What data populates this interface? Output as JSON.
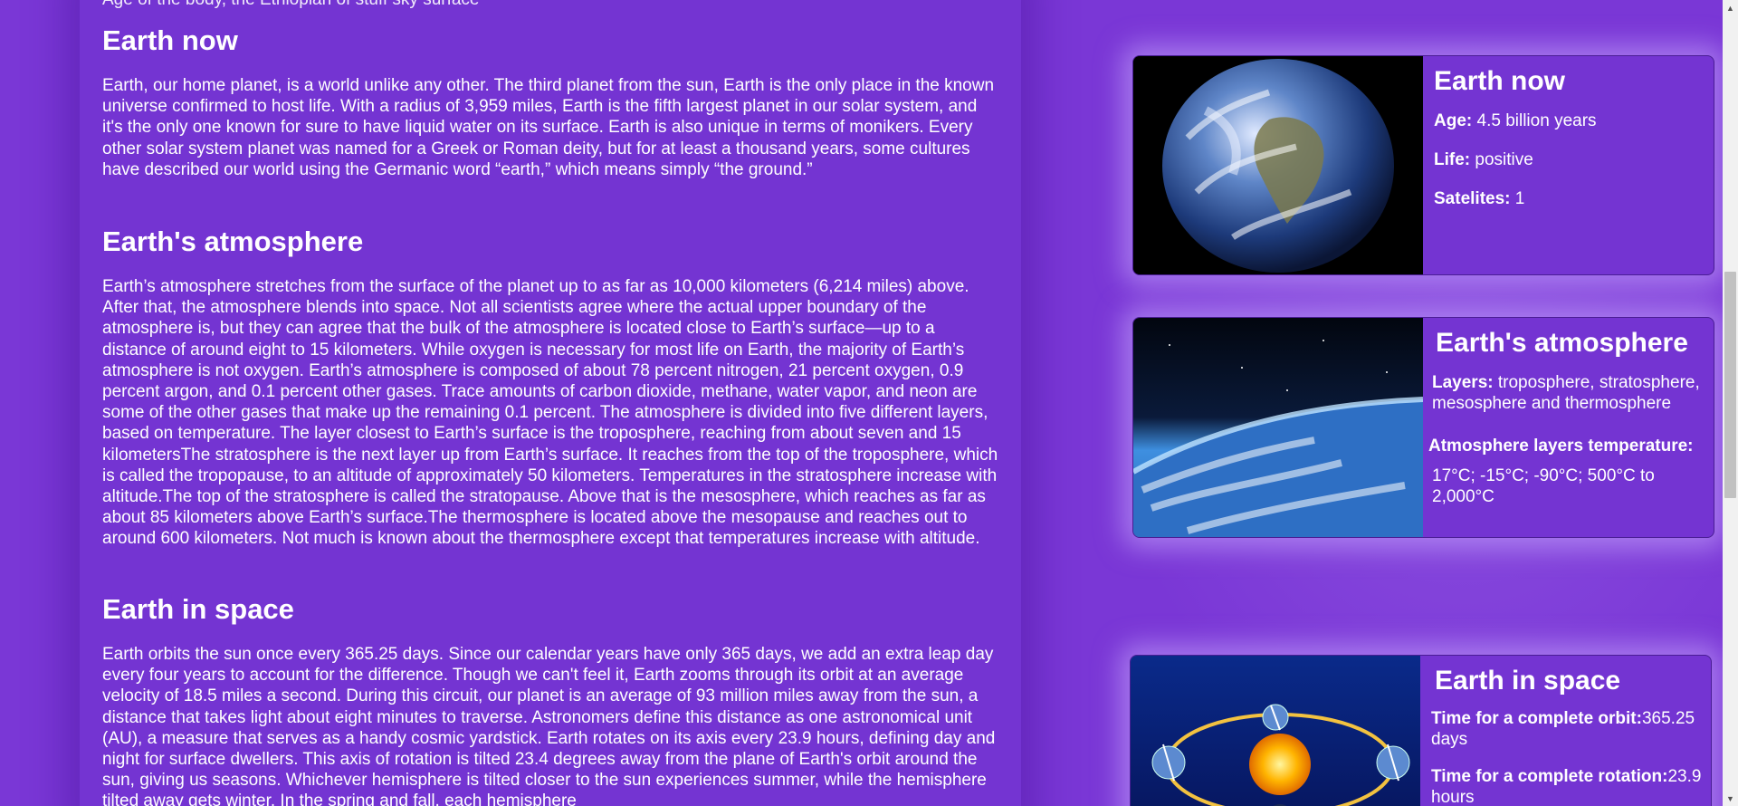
{
  "article": {
    "cut_line": "Age of the body, the Ethiopian of stuff sky surface",
    "sections": [
      {
        "heading": "Earth now",
        "body": "Earth, our home planet, is a world unlike any other. The third planet from the sun, Earth is the only place in the known universe confirmed to host life. With a radius of 3,959 miles, Earth is the fifth largest planet in our solar system, and it's the only one known for sure to have liquid water on its surface. Earth is also unique in terms of monikers. Every other solar system planet was named for a Greek or Roman deity, but for at least a thousand years, some cultures have described our world using the Germanic word “earth,” which means simply “the ground.”"
      },
      {
        "heading": "Earth's atmosphere",
        "body": "Earth’s atmosphere stretches from the surface of the planet up to as far as 10,000 kilometers (6,214 miles) above. After that, the atmosphere blends into space. Not all scientists agree where the actual upper boundary of the atmosphere is, but they can agree that the bulk of the atmosphere is located close to Earth’s surface—up to a distance of around eight to 15 kilometers. While oxygen is necessary for most life on Earth, the majority of Earth’s atmosphere is not oxygen. Earth’s atmosphere is composed of about 78 percent nitrogen, 21 percent oxygen, 0.9 percent argon, and 0.1 percent other gases. Trace amounts of carbon dioxide, methane, water vapor, and neon are some of the other gases that make up the remaining 0.1 percent. The atmosphere is divided into five different layers, based on temperature. The layer closest to Earth’s surface is the troposphere, reaching from about seven and 15 kilometersThe stratosphere is the next layer up from Earth’s surface. It reaches from the top of the troposphere, which is called the tropopause, to an altitude of approximately 50 kilometers. Temperatures in the stratosphere increase with altitude.The top of the stratosphere is called the stratopause. Above that is the mesosphere, which reaches as far as about 85 kilometers above Earth’s surface.The thermosphere is located above the mesopause and reaches out to around 600 kilometers. Not much is known about the thermosphere except that temperatures increase with altitude."
      },
      {
        "heading": "Earth in space",
        "body": "Earth orbits the sun once every 365.25 days. Since our calendar years have only 365 days, we add an extra leap day every four years to account for the difference. Though we can't feel it, Earth zooms through its orbit at an average velocity of 18.5 miles a second. During this circuit, our planet is an average of 93 million miles away from the sun, a distance that takes light about eight minutes to traverse. Astronomers define this distance as one astronomical unit (AU), a measure that serves as a handy cosmic yardstick. Earth rotates on its axis every 23.9 hours, defining day and night for surface dwellers. This axis of rotation is tilted 23.4 degrees away from the plane of Earth's orbit around the sun, giving us seasons. Whichever hemisphere is tilted closer to the sun experiences summer, while the hemisphere tilted away gets winter. In the spring and fall, each hemisphere"
      }
    ]
  },
  "cards": {
    "now": {
      "title": "Earth now",
      "rows": [
        {
          "label": "Age:",
          "value": " 4.5 billion years"
        },
        {
          "label": "Life:",
          "value": " positive"
        },
        {
          "label": "Satelites:",
          "value": " 1"
        }
      ]
    },
    "atmosphere": {
      "title": "Earth's atmosphere",
      "layers_label": "Layers:",
      "layers_value": " troposphere, stratosphere, mesosphere and thermosphere",
      "temp_label": "Atmosphere layers temperature:",
      "temp_value": "17°C; -15°C; -90°C; 500°C to 2,000°C"
    },
    "space": {
      "title": "Earth in space",
      "orbit_label": "Time for a complete orbit:",
      "orbit_value": "365.25 days",
      "rotation_label": "Time for a complete rotation:",
      "rotation_value": "23.9 hours"
    }
  },
  "icons": {
    "scroll_up": "scroll-up-arrow-icon",
    "scroll_down": "scroll-down-arrow-icon"
  },
  "colors": {
    "background": "#7a37d6",
    "panel": "#7434d2",
    "text": "#ffffff"
  }
}
